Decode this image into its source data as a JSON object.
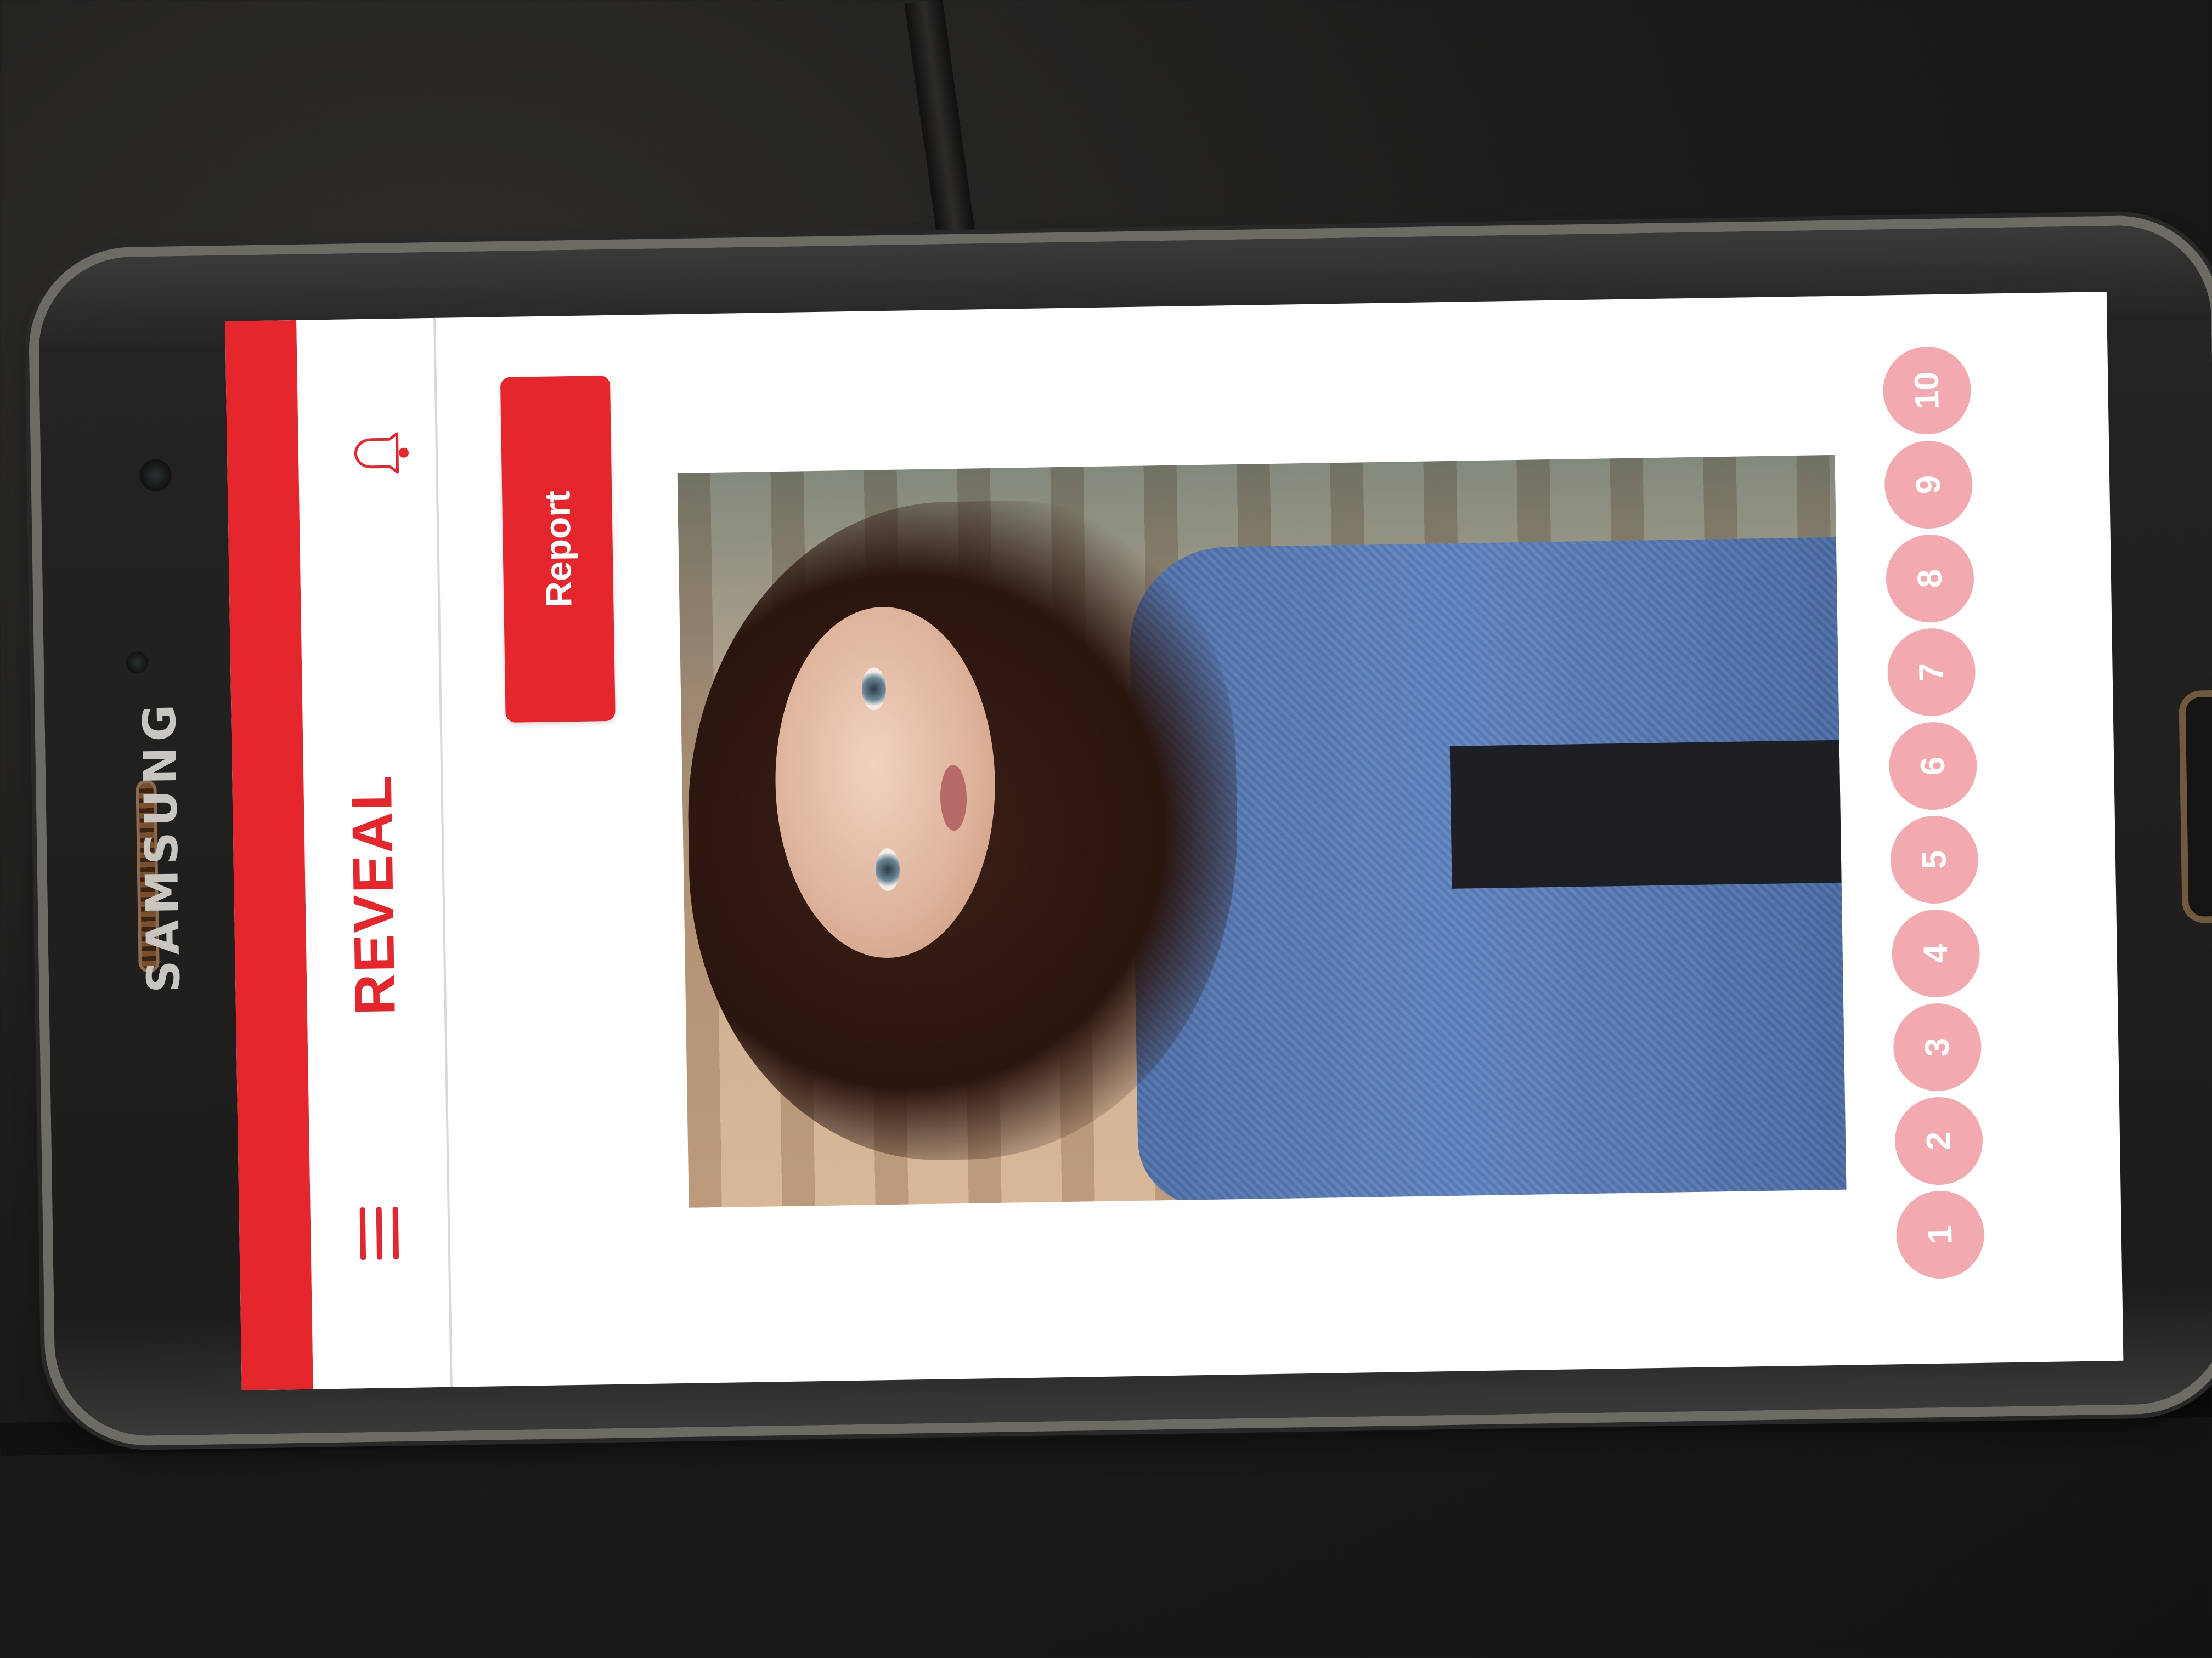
{
  "device": {
    "brand": "SAMSUNG"
  },
  "app": {
    "title": "REVEAL",
    "accent_color": "#e5262d",
    "menu_icon": "hamburger-menu-icon",
    "notification_icon": "bell-icon"
  },
  "actions": {
    "report_label": "Report"
  },
  "rating": {
    "options": [
      "1",
      "2",
      "3",
      "4",
      "5",
      "6",
      "7",
      "8",
      "9",
      "10"
    ],
    "button_color": "#f2a9b0"
  }
}
